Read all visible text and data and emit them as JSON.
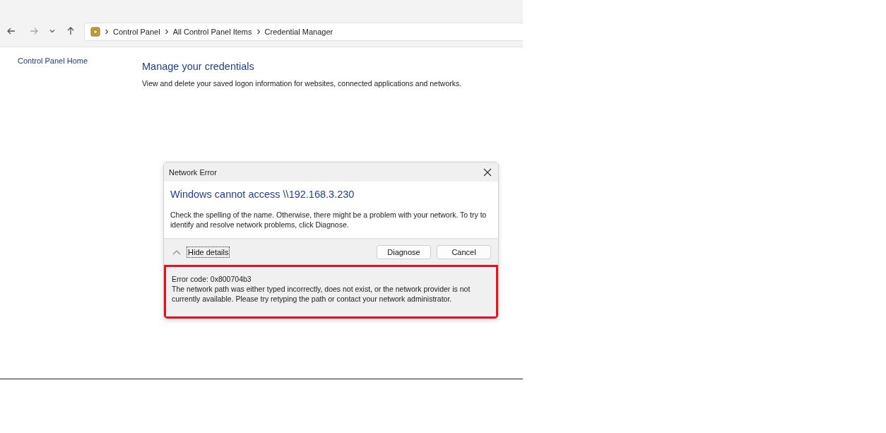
{
  "breadcrumb": [
    "Control Panel",
    "All Control Panel Items",
    "Credential Manager"
  ],
  "sidebar": {
    "link": "Control Panel Home"
  },
  "main": {
    "title": "Manage your credentials",
    "description": "View and delete your saved logon information for websites, connected applications and networks."
  },
  "dialog": {
    "title": "Network Error",
    "heading": "Windows cannot access \\\\192.168.3.230",
    "message": "Check the spelling of the name. Otherwise, there might be a problem with your network. To try to identify and resolve network problems, click Diagnose.",
    "details_toggle": {
      "label": "Hide details",
      "expanded": true
    },
    "buttons": [
      "Diagnose",
      "Cancel"
    ],
    "details": {
      "highlighted": true,
      "lines": [
        "Error code: 0x800704b3",
        "The network path was either typed incorrectly, does not exist, or the network provider is not currently available. Please try retyping the path or contact your network administrator."
      ]
    }
  }
}
